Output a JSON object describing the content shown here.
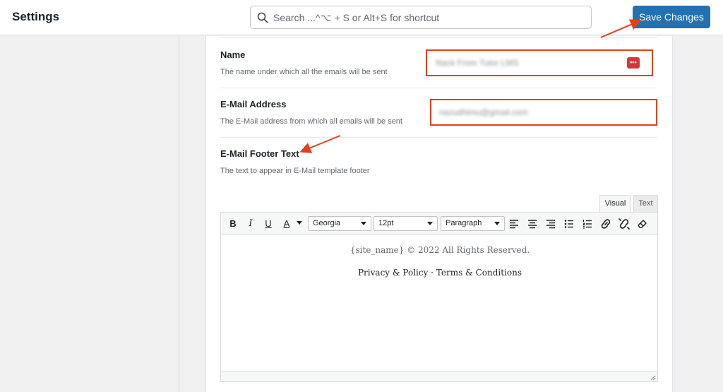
{
  "header": {
    "title": "Settings",
    "search_placeholder": "Search ...^⌥ + S or Alt+S for shortcut",
    "save_label": "Save Changes"
  },
  "fields": {
    "name": {
      "title": "Name",
      "description": "The name under which all the emails will be sent",
      "value": "Nack From Tutor LMS"
    },
    "email": {
      "title": "E-Mail Address",
      "description": "The E-Mail address from which all emails will be sent",
      "value": "nazudhimu@gmail.com"
    },
    "footer": {
      "title": "E-Mail Footer Text",
      "description": "The text to appear in E-Mail template footer"
    }
  },
  "editor": {
    "tabs": [
      "Visual",
      "Text"
    ],
    "toolbar": {
      "bold": "B",
      "italic": "I",
      "underline": "U",
      "text_color": "A",
      "font_family": "Georgia",
      "font_size": "12pt",
      "block_format": "Paragraph"
    },
    "content": {
      "line1": "{site_name} © 2022 All Rights Reserved.",
      "line2": "Privacy & Policy · Terms & Conditions"
    }
  },
  "colors": {
    "accent": "#2271b1",
    "highlight": "#e2401c"
  },
  "icons": [
    "search-icon",
    "password-manager-icon",
    "align-left-icon",
    "align-center-icon",
    "align-right-icon",
    "bullet-list-icon",
    "numbered-list-icon",
    "link-icon",
    "unlink-icon",
    "clear-formatting-icon",
    "resize-handle-icon"
  ]
}
